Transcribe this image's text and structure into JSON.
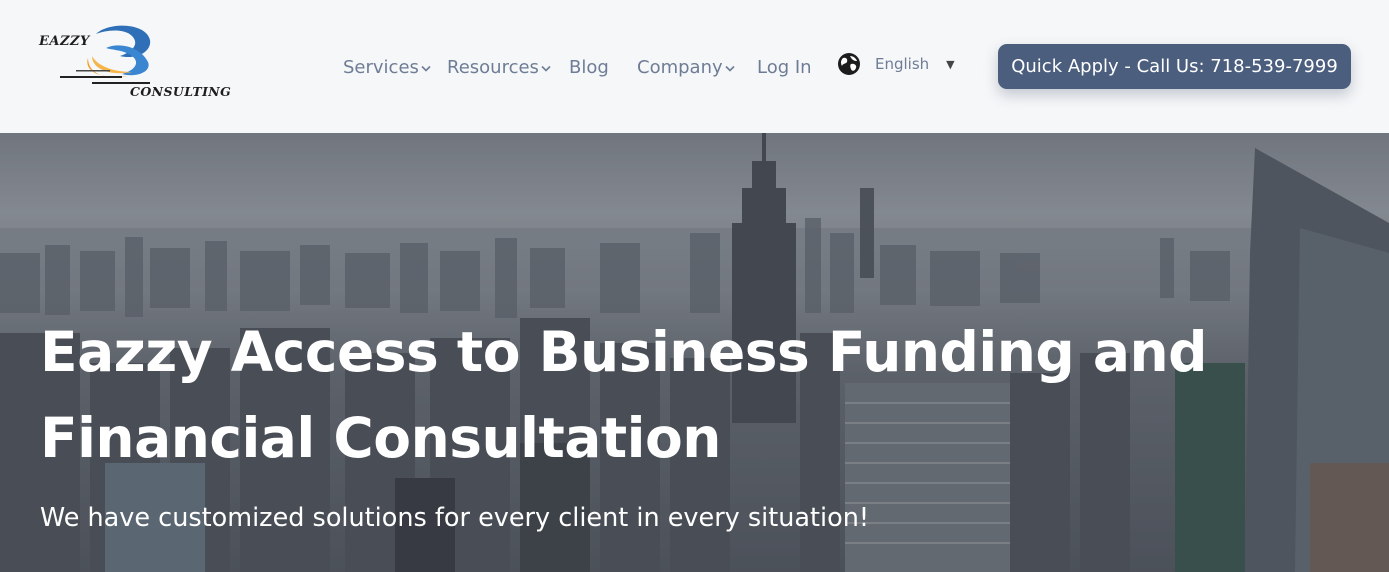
{
  "brand": {
    "logo_top": "EAZZY",
    "logo_bottom": "CONSULTING",
    "colors": {
      "blue": "#2e6fb8",
      "orange": "#f29a1f"
    }
  },
  "nav": {
    "items": [
      {
        "label": "Services",
        "has_dropdown": true
      },
      {
        "label": "Resources",
        "has_dropdown": true
      },
      {
        "label": "Blog",
        "has_dropdown": false
      },
      {
        "label": "Company",
        "has_dropdown": true
      },
      {
        "label": "Log In",
        "has_dropdown": false
      }
    ],
    "language": {
      "icon": "globe-icon",
      "selected": "English"
    },
    "cta_label": "Quick Apply - Call Us: 718-539-7999",
    "colors": {
      "text": "#6e7d95",
      "cta_bg": "#4b5e7e"
    }
  },
  "hero": {
    "title": "Eazzy Access to Business Funding and Financial Consultation",
    "subtitle": "We have customized solutions for every client in every situation!"
  }
}
